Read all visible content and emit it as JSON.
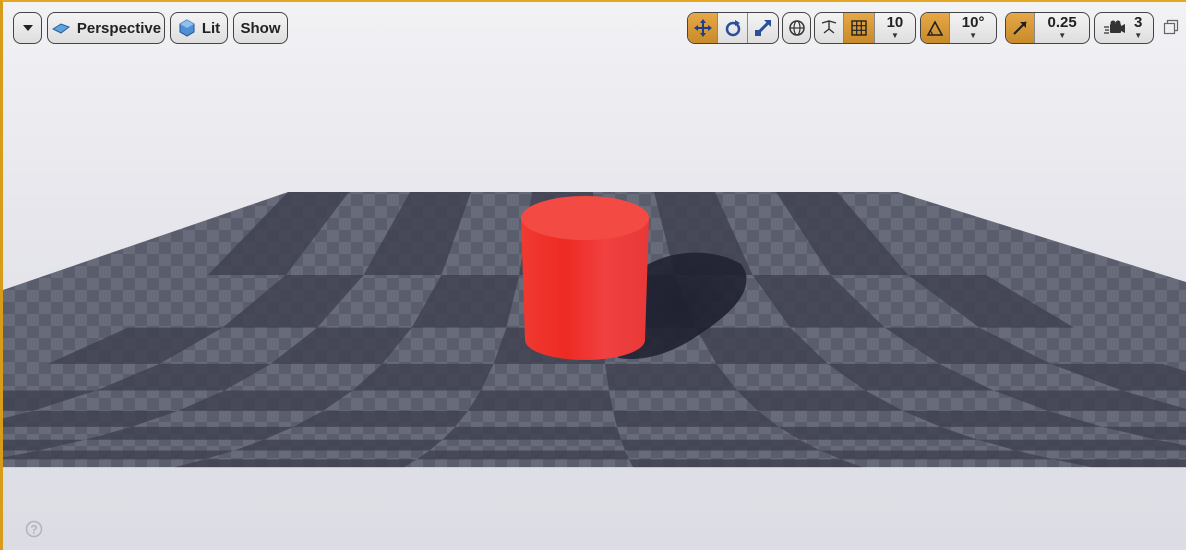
{
  "toolbar": {
    "view_mode": "Perspective",
    "lighting_mode": "Lit",
    "show_label": "Show",
    "grid_snap_value": "10",
    "rotation_snap_value": "10°",
    "scale_snap_value": "0.25",
    "camera_speed_value": "3"
  },
  "colors": {
    "accent": "#d89c1a",
    "active_button": "#d99a35",
    "cylinder": "#f03030",
    "floor_dark": "#4a4d5c",
    "floor_light": "#646878"
  },
  "icons": {
    "options": "chevron-down-icon",
    "perspective": "perspective-icon",
    "lit": "lit-cube-icon",
    "translate": "translate-icon",
    "rotate": "rotate-icon",
    "scale": "scale-icon",
    "world": "world-icon",
    "surface_snap": "surface-snap-icon",
    "grid": "grid-icon",
    "angle": "angle-icon",
    "scale_snap": "scale-snap-icon",
    "camera_speed": "camera-speed-icon",
    "help": "help-icon",
    "restore": "restore-icon"
  }
}
